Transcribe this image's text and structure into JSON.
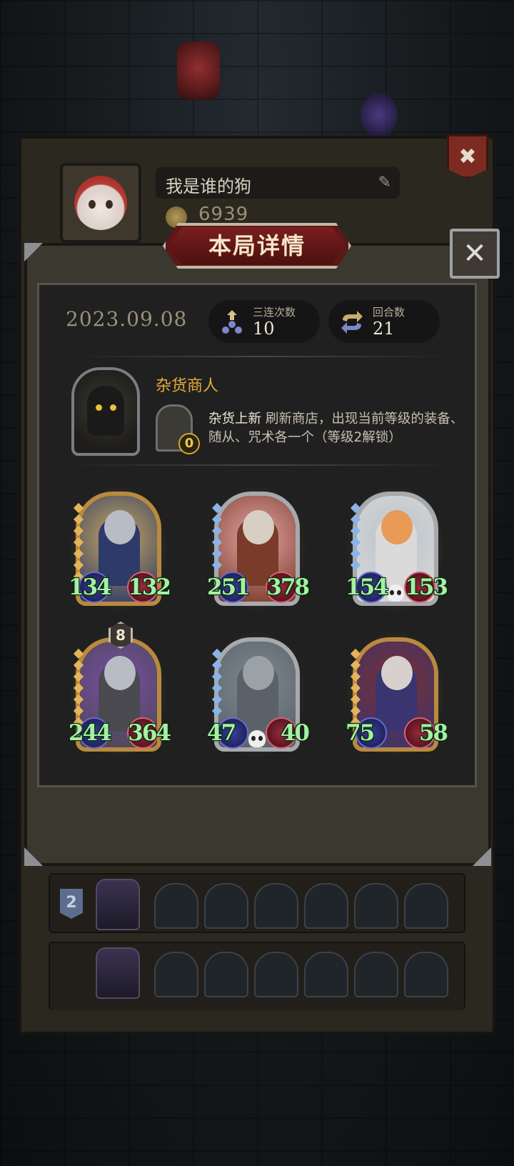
{
  "profile": {
    "name": "我是谁的狗",
    "coins": "6939"
  },
  "dialog": {
    "title": "本局详情",
    "close_label": "✕"
  },
  "stats": {
    "date": "2023.09.08",
    "triples_label": "三连次数",
    "triples_value": "10",
    "rounds_label": "回合数",
    "rounds_value": "21"
  },
  "merchant": {
    "name": "杂货商人",
    "skill_cost": "0",
    "skill_name": "杂货上新",
    "skill_desc": "刷新商店，出现当前等级的装备、随从、咒术各一个（等级2解锁）"
  },
  "units": [
    {
      "atk": "134",
      "hp": "132",
      "frame": "gold",
      "level": "",
      "skull": false
    },
    {
      "atk": "251",
      "hp": "378",
      "frame": "silver",
      "level": "",
      "skull": false
    },
    {
      "atk": "154",
      "hp": "153",
      "frame": "silver",
      "level": "",
      "skull": true
    },
    {
      "atk": "244",
      "hp": "364",
      "frame": "gold",
      "level": "8",
      "skull": false
    },
    {
      "atk": "47",
      "hp": "40",
      "frame": "silver",
      "level": "",
      "skull": true
    },
    {
      "atk": "75",
      "hp": "58",
      "frame": "gold",
      "level": "",
      "skull": false
    }
  ],
  "lineup": {
    "rank": "2"
  },
  "colors": {
    "accent_gold": "#e2ab3c",
    "stat_green": "#a4f0a6",
    "banner_red": "#5c1717"
  }
}
